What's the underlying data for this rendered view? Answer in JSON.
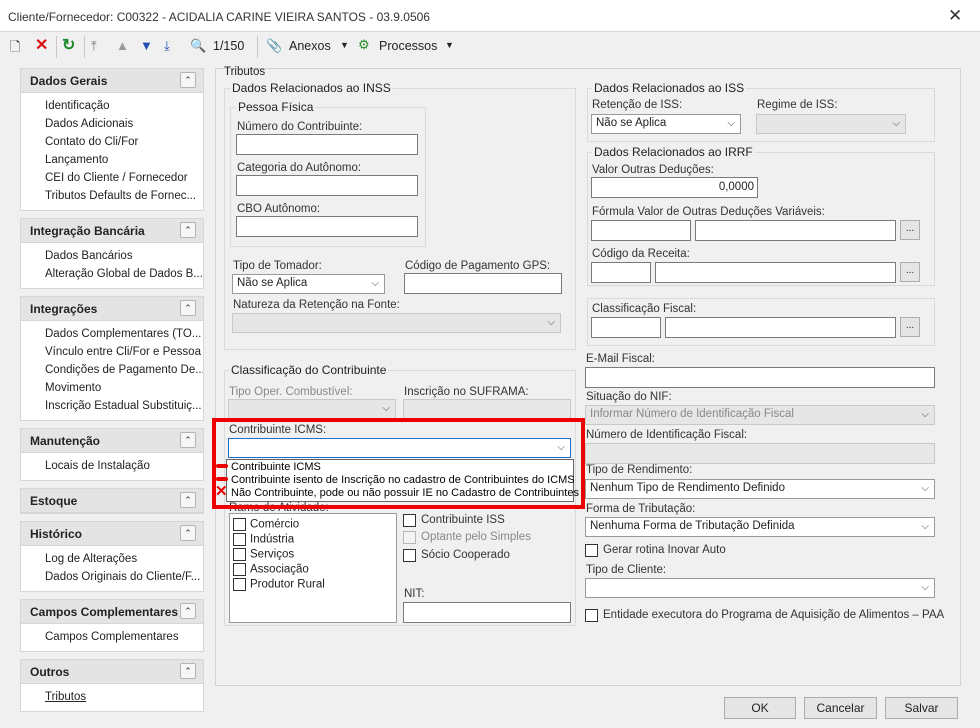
{
  "window": {
    "title": "Cliente/Fornecedor: C00322 - ACIDALIA CARINE VIEIRA SANTOS - 03.9.0506"
  },
  "toolbar": {
    "record_counter": "1/150",
    "attachments_label": "Anexos",
    "processes_label": "Processos"
  },
  "sidebar": {
    "groups": [
      {
        "title": "Dados Gerais",
        "items": [
          "Identificação",
          "Dados Adicionais",
          "Contato do Cli/For",
          "Lançamento",
          "CEI do Cliente / Fornecedor",
          "Tributos Defaults de Fornec..."
        ]
      },
      {
        "title": "Integração Bancária",
        "items": [
          "Dados Bancários",
          "Alteração Global de Dados B..."
        ]
      },
      {
        "title": "Integrações",
        "items": [
          "Dados Complementares (TO...",
          "Vínculo entre Cli/For e Pessoa",
          "Condições de Pagamento De...",
          "Movimento",
          "Inscrição Estadual Substituiç..."
        ]
      },
      {
        "title": "Manutenção",
        "items": [
          "Locais de Instalação"
        ]
      },
      {
        "title": "Estoque",
        "items": []
      },
      {
        "title": "Histórico",
        "items": [
          "Log de Alterações",
          "Dados Originais do Cliente/F..."
        ]
      },
      {
        "title": "Campos Complementares",
        "items": [
          "Campos Complementares"
        ]
      },
      {
        "title": "Outros",
        "items": [
          "Tributos"
        ]
      }
    ]
  },
  "main": {
    "title": "Tributos",
    "inss": {
      "legend": "Dados Relacionados ao INSS",
      "pf_legend": "Pessoa Física",
      "numero_label": "Número do Contribuinte:",
      "categoria_label": "Categoria do Autônomo:",
      "cbo_label": "CBO Autônomo:",
      "tipo_tomador_label": "Tipo de Tomador:",
      "tipo_tomador_value": "Não se Aplica",
      "gps_label": "Código de Pagamento GPS:",
      "natureza_label": "Natureza da Retenção na Fonte:"
    },
    "classif": {
      "legend": "Classificação do Contribuinte",
      "tipo_oper_label": "Tipo Oper. Combustível:",
      "suframa_label": "Inscrição no SUFRAMA:",
      "icms_label": "Contribuinte ICMS:",
      "ramo_label": "Ramo de Atividade:",
      "ramo_items": [
        "Comércio",
        "Indústria",
        "Serviços",
        "Associação",
        "Produtor Rural"
      ],
      "contribuinte_iss": "Contribuinte ISS",
      "optante_simples": "Optante pelo Simples",
      "socio_cooperado": "Sócio Cooperado",
      "nit_label": "NIT:"
    },
    "icms_dropdown": [
      "Contribuinte ICMS",
      "Contribuinte isento de Inscrição no cadastro de Contribuintes do ICMS",
      "Não Contribuinte, pode ou não possuir IE no Cadastro de Contribuintes"
    ],
    "iss": {
      "legend": "Dados Relacionados ao ISS",
      "retencao_label": "Retenção de ISS:",
      "retencao_value": "Não se Aplica",
      "regime_label": "Regime de ISS:"
    },
    "irrf": {
      "legend": "Dados Relacionados ao IRRF",
      "valor_label": "Valor Outras Deduções:",
      "valor_value": "0,0000",
      "formula_label": "Fórmula Valor de Outras Deduções Variáveis:",
      "codigo_label": "Código da Receita:"
    },
    "classif_fiscal_label": "Classificação Fiscal:",
    "email_fiscal_label": "E-Mail Fiscal:",
    "situacao_nif_label": "Situação do NIF:",
    "situacao_nif_value": "Informar Número de Identificação Fiscal",
    "numero_nif_label": "Número de Identificação Fiscal:",
    "tipo_rendimento_label": "Tipo de Rendimento:",
    "tipo_rendimento_value": "Nenhum Tipo de Rendimento Definido",
    "forma_tributacao_label": "Forma de Tributação:",
    "forma_tributacao_value": "Nenhuma Forma de Tributação Definida",
    "gerar_rotina_label": "Gerar rotina Inovar Auto",
    "tipo_cliente_label": "Tipo de Cliente:",
    "entidade_paa_label": "Entidade executora do Programa de Aquisição de Alimentos – PAA"
  },
  "footer": {
    "ok_label": "OK",
    "cancel_label": "Cancelar",
    "save_label": "Salvar"
  },
  "colors": {
    "highlight": "#e00000",
    "accent": "#1f6fc5"
  }
}
